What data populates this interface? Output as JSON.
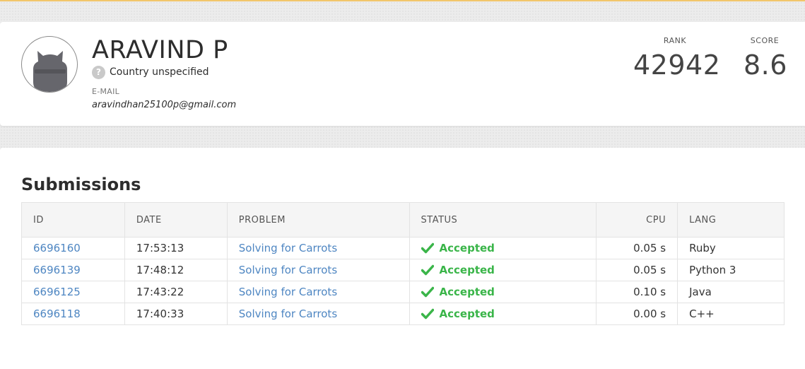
{
  "profile": {
    "name": "ARAVIND P",
    "country": "Country unspecified",
    "country_icon": "question-icon",
    "email_label": "E-MAIL",
    "email": "aravindhan25100p@gmail.com",
    "rank_label": "RANK",
    "rank": "42942",
    "score_label": "SCORE",
    "score": "8.6"
  },
  "submissions": {
    "title": "Submissions",
    "columns": [
      "ID",
      "DATE",
      "PROBLEM",
      "STATUS",
      "CPU",
      "LANG"
    ],
    "rows": [
      {
        "id": "6696160",
        "date": "17:53:13",
        "problem": "Solving for Carrots",
        "status": "Accepted",
        "cpu": "0.05 s",
        "lang": "Ruby"
      },
      {
        "id": "6696139",
        "date": "17:48:12",
        "problem": "Solving for Carrots",
        "status": "Accepted",
        "cpu": "0.05 s",
        "lang": "Python 3"
      },
      {
        "id": "6696125",
        "date": "17:43:22",
        "problem": "Solving for Carrots",
        "status": "Accepted",
        "cpu": "0.10 s",
        "lang": "Java"
      },
      {
        "id": "6696118",
        "date": "17:40:33",
        "problem": "Solving for Carrots",
        "status": "Accepted",
        "cpu": "0.00 s",
        "lang": "C++"
      }
    ]
  },
  "colors": {
    "accent_link": "#4e86c2",
    "accepted": "#3ab549",
    "top_strip": "#f2c66b"
  }
}
